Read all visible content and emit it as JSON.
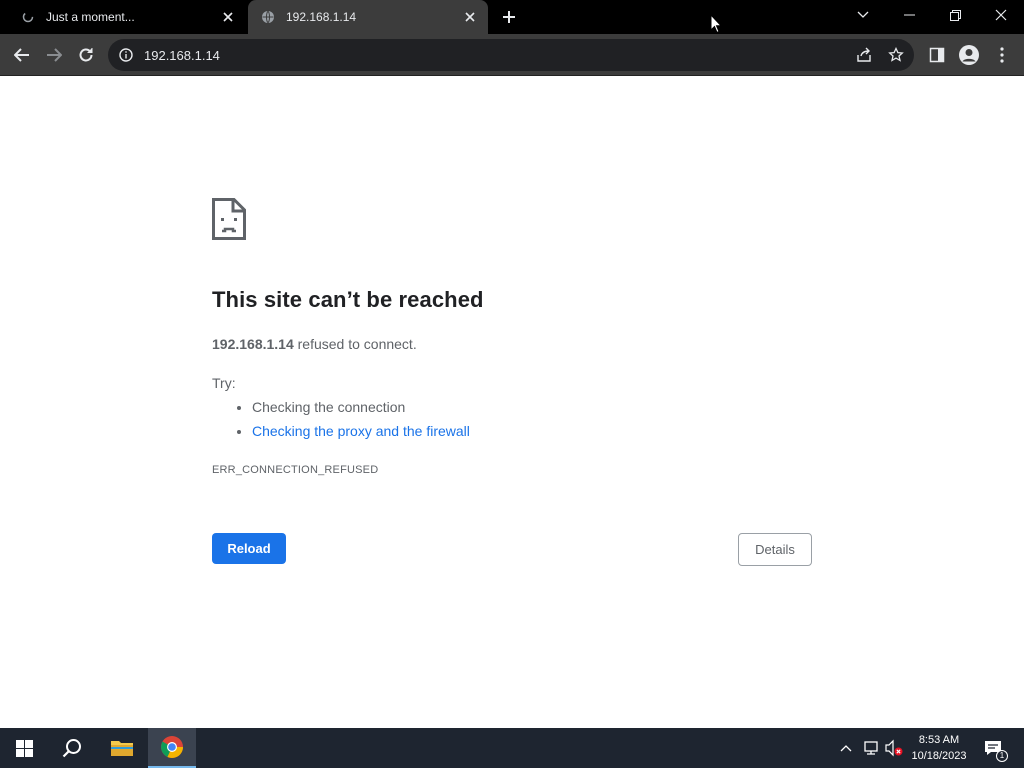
{
  "tabs": [
    {
      "title": "Just a moment..."
    },
    {
      "title": "192.168.1.14"
    }
  ],
  "toolbar": {
    "url": "192.168.1.14"
  },
  "error": {
    "title": "This site can’t be reached",
    "host": "192.168.1.14",
    "description": " refused to connect.",
    "try_label": "Try:",
    "suggestions": [
      "Checking the connection",
      "Checking the proxy and the firewall"
    ],
    "code": "ERR_CONNECTION_REFUSED",
    "reload_label": "Reload",
    "details_label": "Details"
  },
  "taskbar": {
    "time": "8:53 AM",
    "date": "10/18/2023",
    "notification_count": "1"
  },
  "colors": {
    "accent": "#1a73e8",
    "tab_active": "#3c3c3c",
    "tabstrip": "#000000",
    "taskbar": "#1e2530"
  }
}
